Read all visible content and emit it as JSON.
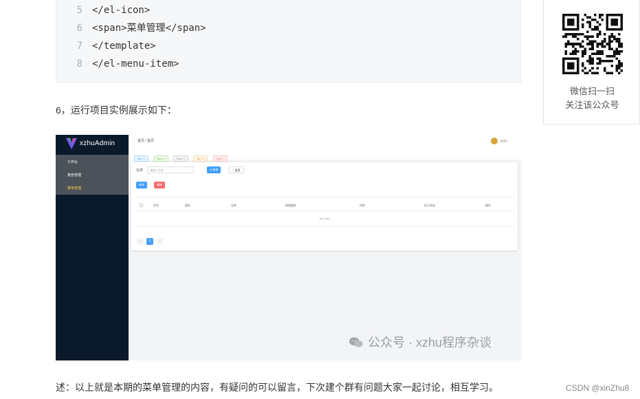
{
  "code": {
    "lines": [
      {
        "num": "5",
        "text": "</el-icon>"
      },
      {
        "num": "6",
        "text": "<span>菜单管理</span>"
      },
      {
        "num": "7",
        "text": "</template>"
      },
      {
        "num": "8",
        "text": "</el-menu-item>"
      }
    ]
  },
  "paragraph_top": "6，运行项目实例展示如下：",
  "paragraph_bottom": "述：以上就是本期的菜单管理的内容，有疑问的可以留言，下次建个群有问题大家一起讨论，相互学习。",
  "qr": {
    "caption_line1": "微信扫一扫",
    "caption_line2": "关注该公众号"
  },
  "screenshot": {
    "logo_text": "xzhuAdmin",
    "menu_items": [
      "工作台",
      "角色管理",
      "菜单管理"
    ],
    "breadcrumb": "首页  /  首页",
    "user": "xzhu",
    "tags": [
      {
        "label": "Tag 1 ×",
        "color": "#409eff"
      },
      {
        "label": "Tag 2 ×",
        "color": "#67c23a"
      },
      {
        "label": "Tag 3 ×",
        "color": "#909399"
      },
      {
        "label": "Tag 4 ×",
        "color": "#e6a23c"
      },
      {
        "label": "Tag 5 ×",
        "color": "#f56c6c"
      }
    ],
    "search_label": "名称",
    "search_placeholder": "请输入名称",
    "query_btn": "Q 查询",
    "reset_btn": "○ 重置",
    "add_btn": "新增",
    "delete_btn": "删除",
    "columns": [
      "序号",
      "图标",
      "名称",
      "权限路径",
      "排序",
      "显示状态",
      "操作"
    ],
    "no_data": "No Data",
    "pages": [
      "<",
      "1",
      ">"
    ],
    "watermark": "公众号 · xzhu程序杂谈"
  },
  "csdn": "CSDN @xinZhu8"
}
